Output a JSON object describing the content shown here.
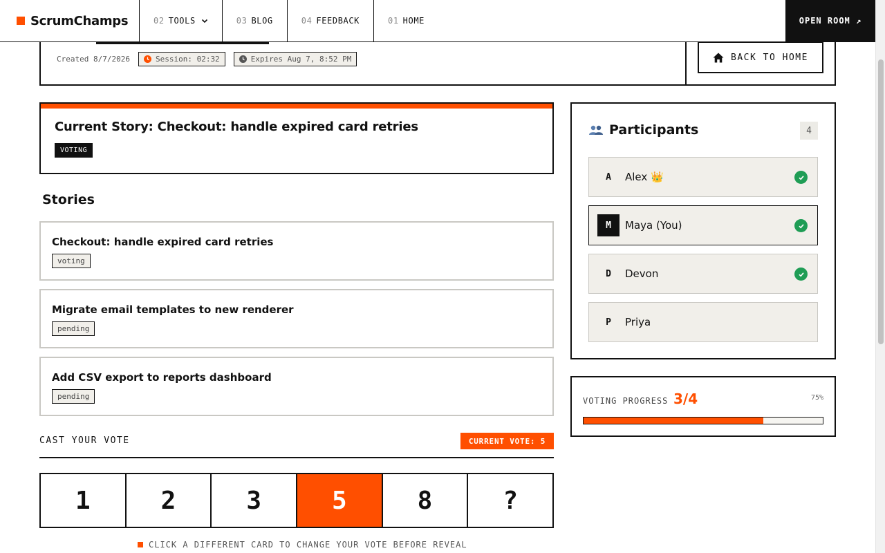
{
  "brand": {
    "name": "ScrumChamps",
    "accent": "#ff4f00"
  },
  "nav": {
    "items": [
      {
        "num": "02",
        "label": "TOOLS",
        "icon": "chevron-down-icon"
      },
      {
        "num": "03",
        "label": "BLOG"
      },
      {
        "num": "04",
        "label": "FEEDBACK"
      },
      {
        "num": "01",
        "label": "HOME"
      }
    ],
    "open_room": "OPEN ROOM ↗"
  },
  "room": {
    "created": "Created 8/7/2026",
    "session": "Session: 02:32",
    "expires": "Expires Aug 7, 8:52 PM",
    "back_button": "BACK TO HOME"
  },
  "current_story": {
    "title": "Current Story: Checkout: handle expired card retries",
    "status": "VOTING"
  },
  "stories": {
    "heading": "Stories",
    "items": [
      {
        "title": "Checkout: handle expired card retries",
        "status": "voting"
      },
      {
        "title": "Migrate email templates to new renderer",
        "status": "pending"
      },
      {
        "title": "Add CSV export to reports dashboard",
        "status": "pending"
      }
    ]
  },
  "vote": {
    "label": "CAST YOUR VOTE",
    "current": "CURRENT VOTE: 5",
    "cards": [
      "1",
      "2",
      "3",
      "5",
      "8",
      "?"
    ],
    "selected": "5",
    "hint": "CLICK A DIFFERENT CARD TO CHANGE YOUR VOTE BEFORE REVEAL"
  },
  "participants": {
    "title": "Participants",
    "count": "4",
    "list": [
      {
        "initial": "A",
        "name": "Alex 👑",
        "voted": true,
        "is_me": false
      },
      {
        "initial": "M",
        "name": "Maya (You)",
        "voted": true,
        "is_me": true
      },
      {
        "initial": "D",
        "name": "Devon",
        "voted": true,
        "is_me": false
      },
      {
        "initial": "P",
        "name": "Priya",
        "voted": false,
        "is_me": false
      }
    ]
  },
  "progress": {
    "label": "VOTING PROGRESS",
    "count": "3/4",
    "percent_text": "75%",
    "fraction": 0.75
  }
}
